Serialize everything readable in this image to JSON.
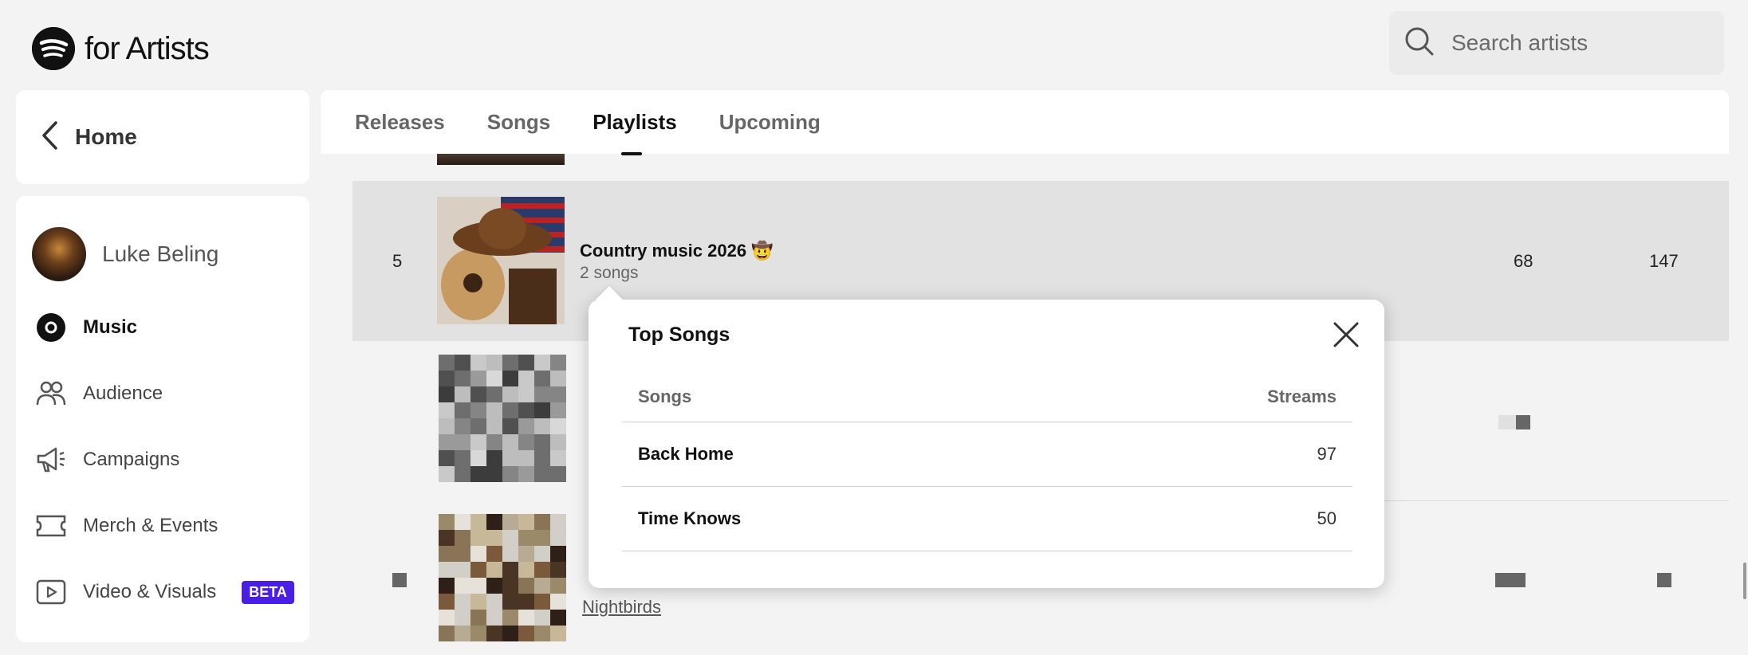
{
  "app": {
    "logo_text": "for Artists"
  },
  "search": {
    "placeholder": "Search artists"
  },
  "sidebar": {
    "home_label": "Home",
    "artist_name": "Luke Beling",
    "items": [
      {
        "label": "Music",
        "icon": "music-disc-icon",
        "active": true
      },
      {
        "label": "Audience",
        "icon": "audience-icon"
      },
      {
        "label": "Campaigns",
        "icon": "megaphone-icon"
      },
      {
        "label": "Merch & Events",
        "icon": "ticket-icon"
      },
      {
        "label": "Video & Visuals",
        "icon": "video-icon",
        "badge": "BETA"
      }
    ]
  },
  "tabs": [
    {
      "label": "Releases"
    },
    {
      "label": "Songs"
    },
    {
      "label": "Playlists",
      "active": true
    },
    {
      "label": "Upcoming"
    }
  ],
  "playlist_row": {
    "rank": "5",
    "title": "Country music 2026 🤠",
    "subtitle": "2 songs",
    "col1": "68",
    "col2": "147"
  },
  "row_below": {
    "link": "Nightbirds"
  },
  "popup": {
    "title": "Top Songs",
    "col_songs": "Songs",
    "col_streams": "Streams",
    "rows": [
      {
        "song": "Back Home",
        "streams": "97"
      },
      {
        "song": "Time Knows",
        "streams": "50"
      }
    ]
  },
  "colors": {
    "beta_badge": "#4a1ee5",
    "highlight_row": "#e2e2e2"
  }
}
